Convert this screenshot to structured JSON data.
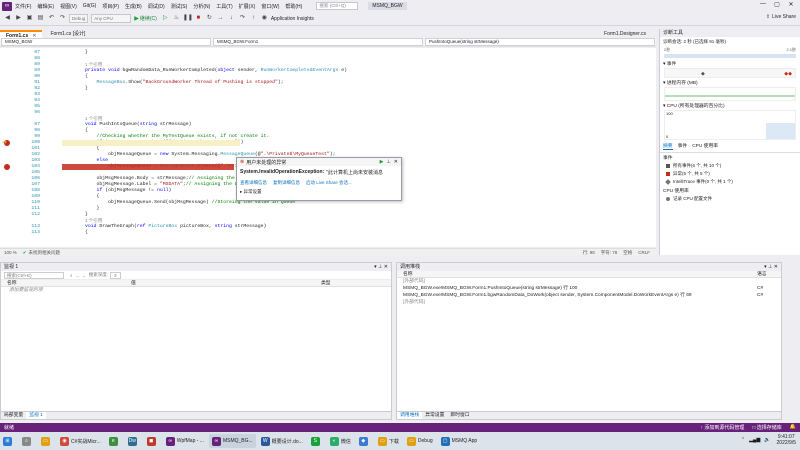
{
  "titlebar": {
    "menu": [
      "文件(F)",
      "编辑(E)",
      "视图(V)",
      "Git(G)",
      "项目(P)",
      "生成(B)",
      "调试(D)",
      "测试(S)",
      "分析(N)",
      "工具(T)",
      "扩展(X)",
      "窗口(W)",
      "帮助(H)"
    ],
    "search_placeholder": "搜索 (Ctrl+Q)",
    "solution": "MSMQ_BGW",
    "live_share": "Live Share"
  },
  "toolbar": {
    "config": "Debug",
    "platform": "Any CPU",
    "continue": "继续(C)",
    "insights": "Application Insights"
  },
  "doc_tabs": [
    "Form1.cs",
    "Form1.cs [设计]",
    "Form1.Designer.cs"
  ],
  "navbar": {
    "project": "MSMQ_BGW",
    "class": "MSMQ_BGW.Form1",
    "member": "PushIntoQueue(string strMessage)"
  },
  "editor": {
    "zoom": "100 %",
    "no_issues": "未找到相关问题",
    "ln": "行: 98",
    "ch": "字符: 78",
    "spc": "空格",
    "crlf": "CRLF"
  },
  "code_lines": [
    {
      "n": "87",
      "t": "        }"
    },
    {
      "n": "88",
      "t": ""
    },
    {
      "n": "89",
      "t": "        ",
      "ref": "1 个引用"
    },
    {
      "n": "89",
      "t": "        private void bgwRandomData_RunWorkerCompleted(object sender, RunWorkerCompletedEventArgs e)"
    },
    {
      "n": "90",
      "t": "        {"
    },
    {
      "n": "91",
      "t": "            MessageBox.Show(\"BackGroundWorker Thread of Pushing is stopped\");"
    },
    {
      "n": "92",
      "t": "        }"
    },
    {
      "n": "93",
      "t": ""
    },
    {
      "n": "94",
      "t": ""
    },
    {
      "n": "95",
      "t": ""
    },
    {
      "n": "96",
      "t": ""
    },
    {
      "n": "",
      "t": "        ",
      "ref": "1 个引用"
    },
    {
      "n": "97",
      "t": "        void PushIntoQueue(string strMessage)"
    },
    {
      "n": "98",
      "t": "        {"
    },
    {
      "n": "99",
      "t": "            //Checking whether the MyTestQueue exists, if not create it."
    },
    {
      "n": "100",
      "t": "            if (MessageQueue.Exists(@\".\\Private$\\MyQueueTest\"))"
    },
    {
      "n": "101",
      "t": "            {"
    },
    {
      "n": "102",
      "t": "                objMessageQueue = new System.Messaging.MessageQueue(@\".\\Private$\\MyQueueTest\");"
    },
    {
      "n": "103",
      "t": "            else"
    },
    {
      "n": "104",
      "t": "                objMessageQueue = MessageQueue.Create(@\".\\Private"
    },
    {
      "n": "105",
      "t": ""
    },
    {
      "n": "106",
      "t": "            objMsgMessage.Body = strMessage;// Assigning the value"
    },
    {
      "n": "107",
      "t": "            objMsgMessage.Label = \"MSDATA\";// Assigning the Label"
    },
    {
      "n": "108",
      "t": "            if (objMsgMessage != null)"
    },
    {
      "n": "109",
      "t": "            {"
    },
    {
      "n": "110",
      "t": "                objMessageQueue.Send(objMsgMessage) //Storeing the value in Queue"
    },
    {
      "n": "111",
      "t": "            }"
    },
    {
      "n": "112",
      "t": "        }"
    },
    {
      "n": "",
      "t": "        ",
      "ref": "1 个引用"
    },
    {
      "n": "113",
      "t": "        void DrawTheGraph(ref PictureBox pictureBox, string strMessage)"
    },
    {
      "n": "114",
      "t": "        {"
    }
  ],
  "exception": {
    "title": "用户未处理的异常",
    "type": "System.InvalidOperationException:",
    "message": "\"此计算机上尚未安装消息",
    "links": [
      "查看详细信息",
      "复制详细信息",
      "启动 Live Share 会话..."
    ],
    "settings": "▸ 异常设置"
  },
  "diagnostics": {
    "title": "诊断工具",
    "session": "诊断会话: 2 秒 (已选择 91 毫秒)",
    "time_left": "2秒",
    "time_right": "2.1秒",
    "events_label": "▾ 事件",
    "memory_label": "▾ 进程内存 (MB)",
    "cpu_label": "▾ CPU (所有处理器的百分比)",
    "axis_top": "100",
    "axis_bottom": "0",
    "tabs": [
      "摘要",
      "事件",
      "CPU 使用率"
    ],
    "events_header": "事件",
    "events": [
      "所有事件(6 个, 共 10 个)",
      "异常(5 个, 共 5 个)",
      "IntelliTrace 事件(0 个, 共 1 个)"
    ],
    "cpu_header": "CPU 使用率",
    "cpu_item": "记录 CPU 配置文件"
  },
  "watch": {
    "title": "监视 1",
    "search_placeholder": "搜索(Ctrl+E)",
    "depth_label": "搜索深度:",
    "depth": "3",
    "columns": [
      "名称",
      "值",
      "类型"
    ],
    "add_item": "添加要监视的项",
    "tabs": [
      "局部变量",
      "监视 1"
    ]
  },
  "callstack": {
    "title": "调用堆栈",
    "columns": [
      "名称",
      "语言"
    ],
    "rows": [
      {
        "name": "[外部代码]",
        "lang": ""
      },
      {
        "name": "MSMQ_BGW.exe!MSMQ_BGW.Form1.PushIntoQueue(string strMessage) 行 100",
        "lang": "C#"
      },
      {
        "name": "MSMQ_BGW.exe!MSMQ_BGW.Form1.bgwRandomData_DoWork(object sender, System.ComponentModel.DoWorkEventArgs e) 行 69",
        "lang": "C#"
      },
      {
        "name": "[外部代码]",
        "lang": ""
      }
    ],
    "tabs": [
      "调用堆栈",
      "异常设置",
      "即时窗口"
    ]
  },
  "vs_status": {
    "left": "就绪",
    "source": "↑ 添加到源代码管理",
    "repo": "□ 选择存储库"
  },
  "taskbar": {
    "apps": [
      "C#实战Micr...",
      "",
      "",
      "",
      "WpfMap - ...",
      "MSMQ_BG...",
      "概要设计.do...",
      "",
      "微信",
      "",
      "下载",
      "Debug",
      "MSMQ App"
    ],
    "time": "9:41:07",
    "date": "2022/9/5"
  }
}
